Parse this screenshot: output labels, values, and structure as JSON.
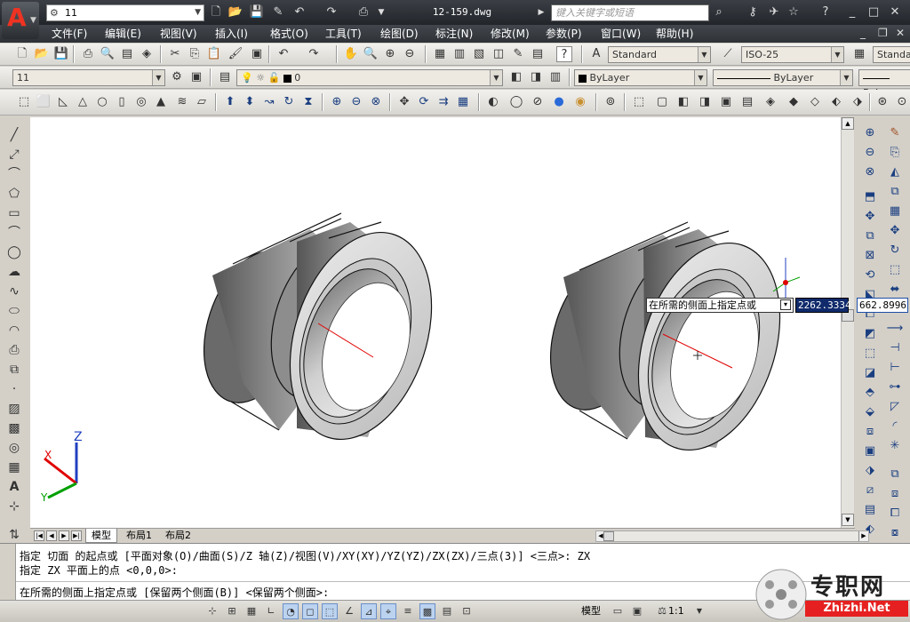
{
  "app": {
    "logo_letter": "A",
    "workspace": "11",
    "document_title": "12-159.dwg",
    "search_placeholder": "键入关键字或短语"
  },
  "menu": [
    "文件(F)",
    "编辑(E)",
    "视图(V)",
    "插入(I)",
    "格式(O)",
    "工具(T)",
    "绘图(D)",
    "标注(N)",
    "修改(M)",
    "参数(P)",
    "窗口(W)",
    "帮助(H)"
  ],
  "styles": {
    "text_style": "Standard",
    "dim_style": "ISO-25",
    "table_style": "Standa"
  },
  "layers": {
    "layer_state": "11",
    "current_layer": "0",
    "color": "ByLayer",
    "linetype": "ByLayer",
    "lineweight": "ByLa"
  },
  "dynamic_input": {
    "prompt": "在所需的侧面上指定点或",
    "x_value": "2262.3334",
    "y_value": "662.8996"
  },
  "ucs": {
    "z_label": "Z",
    "y_label": "Y",
    "x_label": "X"
  },
  "layout_tabs": [
    {
      "label": "模型",
      "active": true
    },
    {
      "label": "布局1",
      "active": false
    },
    {
      "label": "布局2",
      "active": false
    }
  ],
  "command": {
    "line1": "指定 切面 的起点或 [平面对象(O)/曲面(S)/Z 轴(Z)/视图(V)/XY(XY)/YZ(YZ)/ZX(ZX)/三点(3)] <三点>: ZX",
    "line2": "指定 ZX 平面上的点 <0,0,0>:",
    "current": "在所需的侧面上指定点或 [保留两个侧面(B)] <保留两个侧面>:"
  },
  "status": {
    "model_label": "模型",
    "scale": "1:1"
  },
  "watermark": {
    "cn": "专职网",
    "url": "Zhizhi.Net"
  },
  "colors": {
    "title_bar": "#2e3237",
    "cursor_red": "#e00000",
    "cursor_green": "#00a000",
    "cursor_blue": "#2040c0",
    "dyn_highlight": "#102a6b"
  }
}
